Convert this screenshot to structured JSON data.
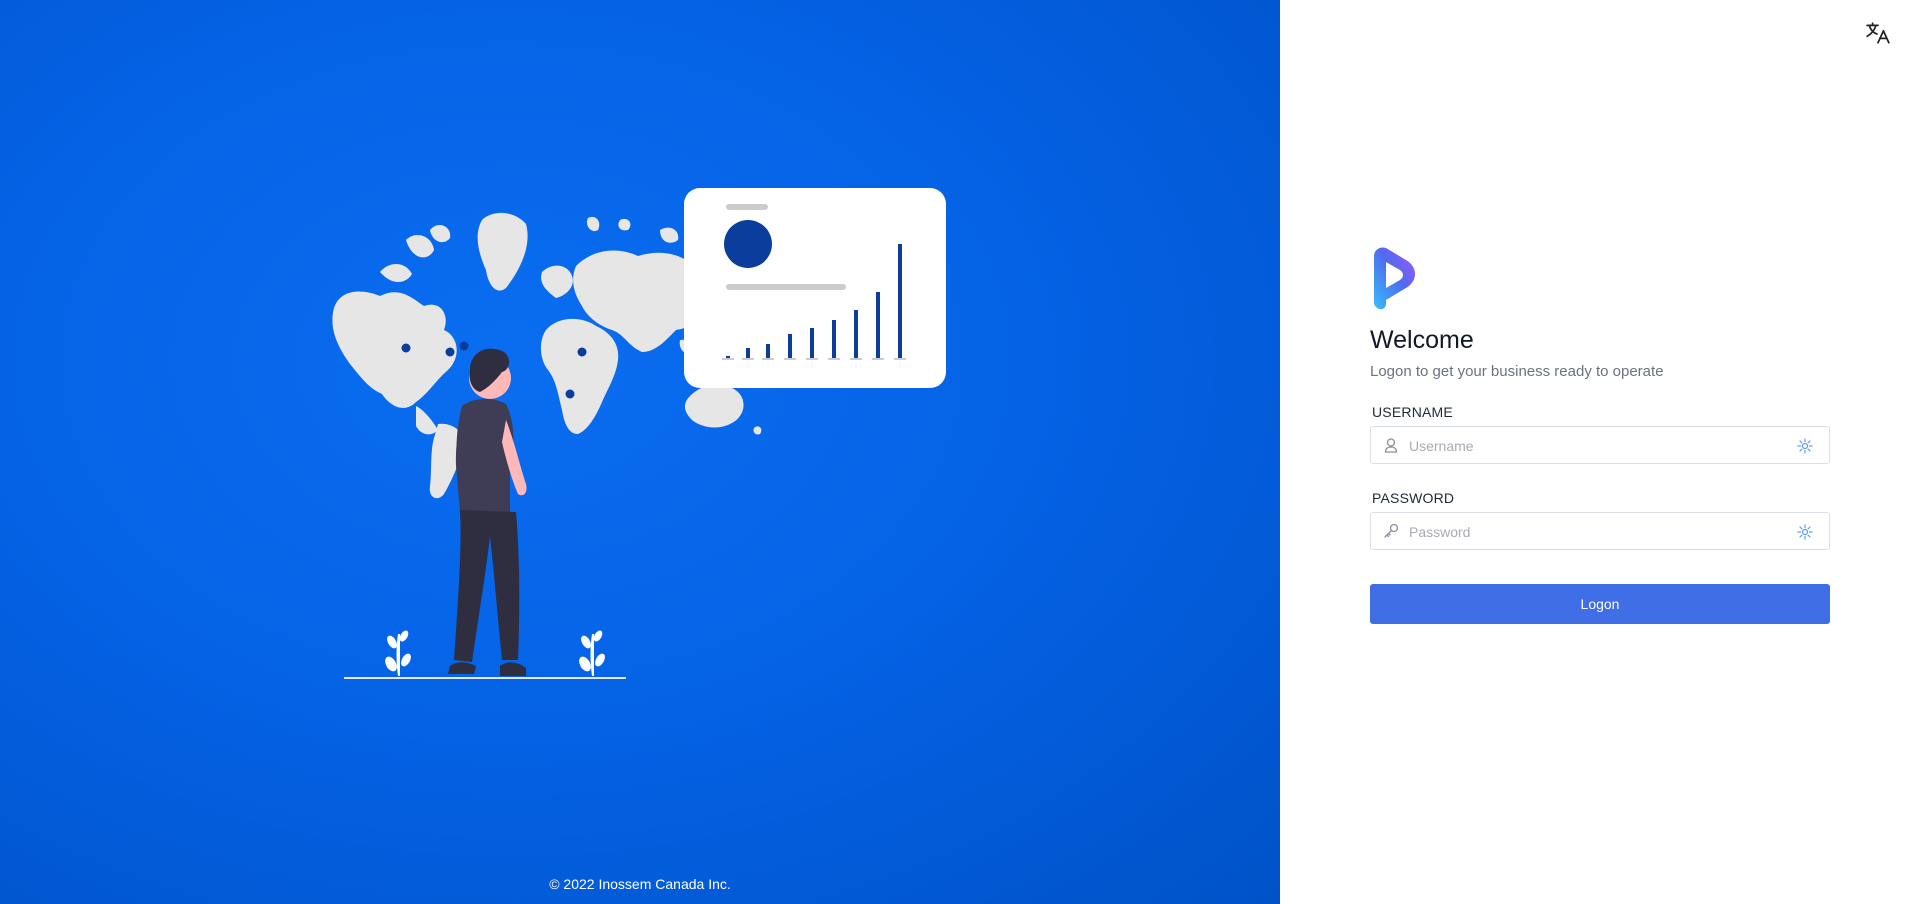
{
  "footer": {
    "copyright": "© 2022 Inossem Canada Inc."
  },
  "header": {
    "language_icon": "translate-icon"
  },
  "login": {
    "title": "Welcome",
    "subtitle": "Logon to get your business ready to operate",
    "username": {
      "label": "USERNAME",
      "placeholder": "Username",
      "value": "",
      "prefix_icon": "user-icon",
      "suffix_icon": "sparkle-icon"
    },
    "password": {
      "label": "PASSWORD",
      "placeholder": "Password",
      "value": "",
      "prefix_icon": "key-icon",
      "suffix_icon": "sparkle-icon"
    },
    "submit_label": "Logon"
  },
  "colors": {
    "left_background": "#0563e6",
    "button": "#3f6ee6",
    "map": "#e6e6e6",
    "accent_dark": "#0a3d9c"
  }
}
